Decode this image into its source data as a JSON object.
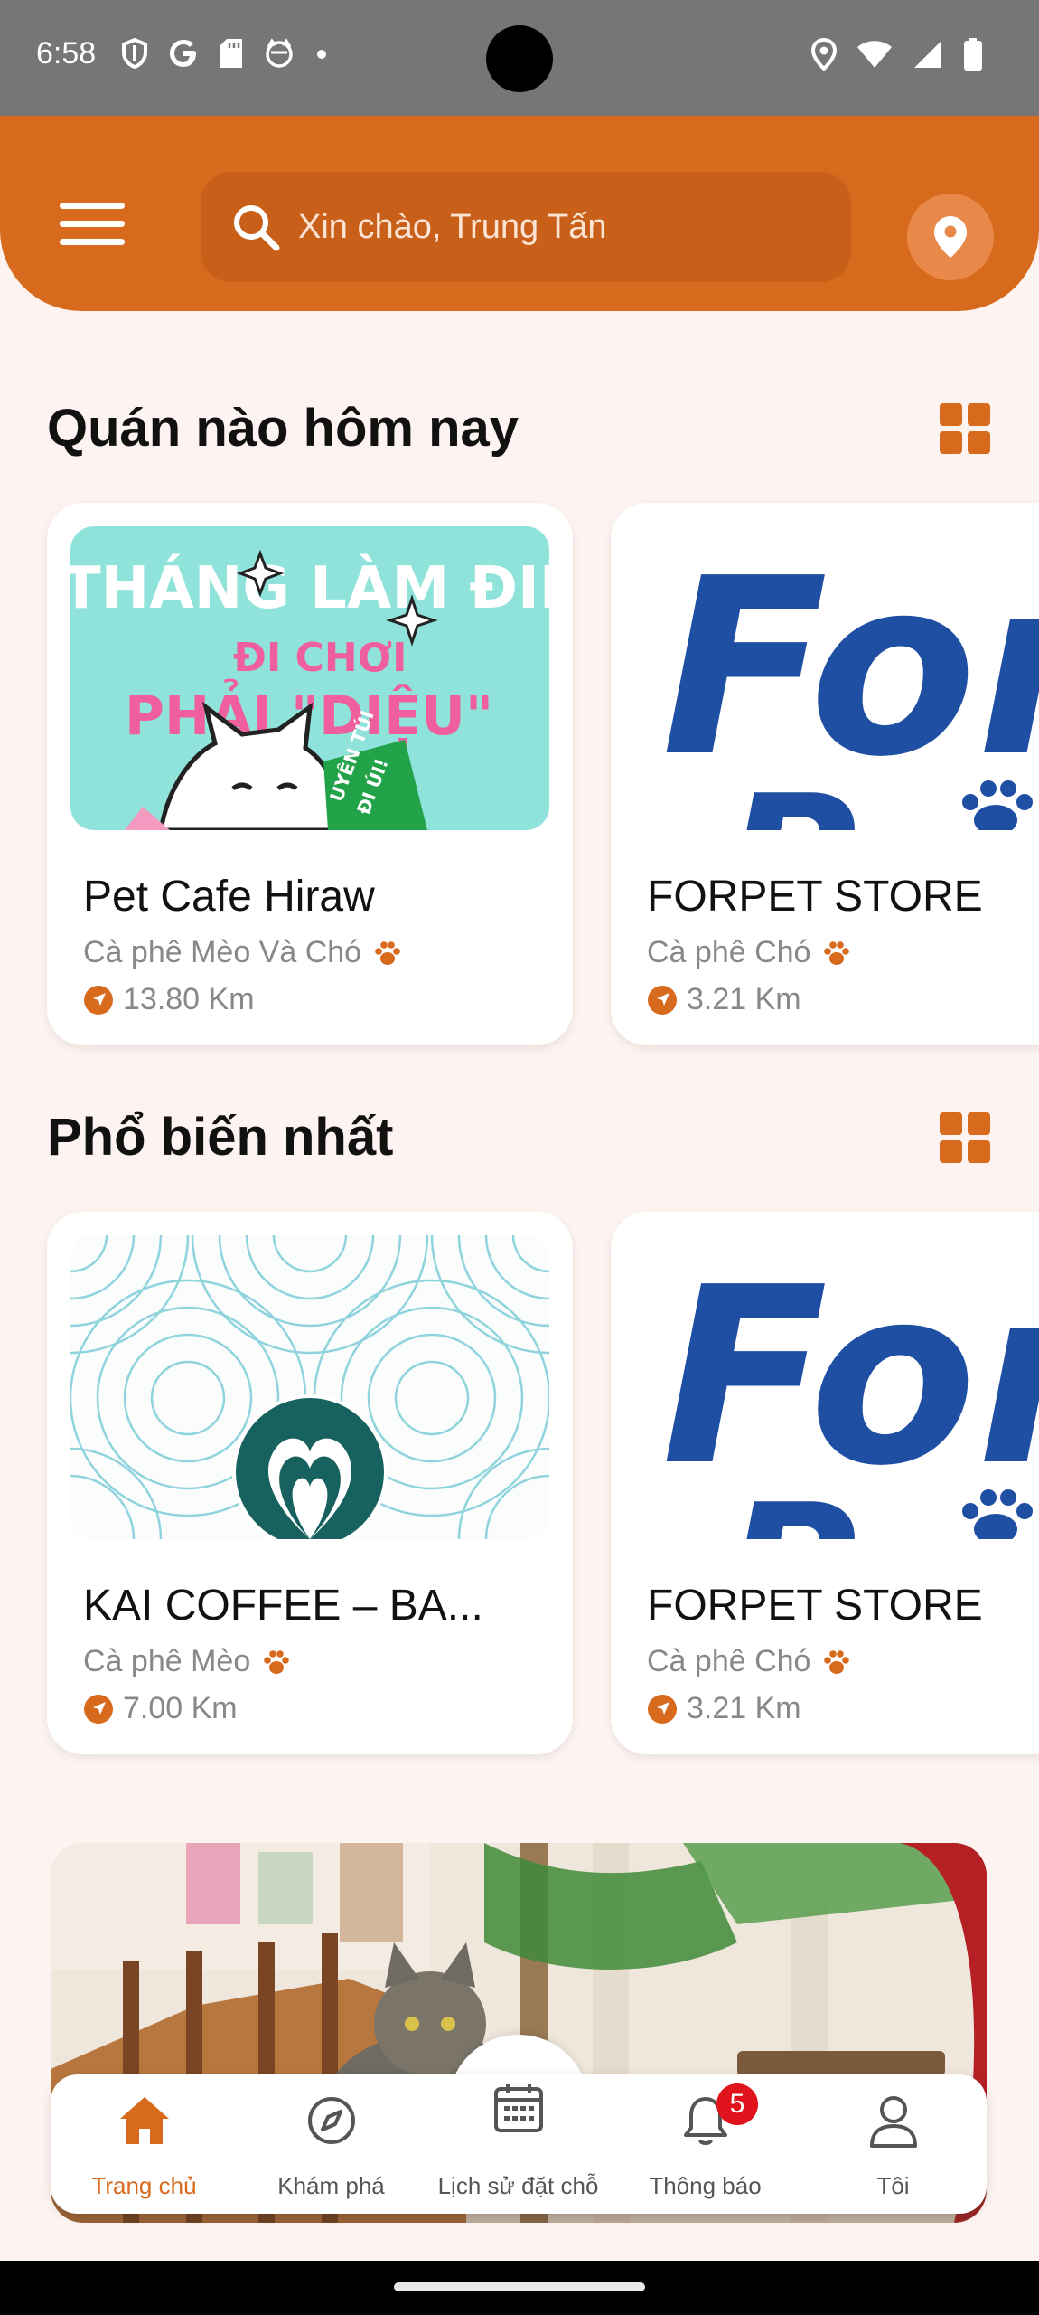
{
  "status_bar": {
    "time": "6:58",
    "left_icons": [
      "shield-icon",
      "google-icon",
      "sd-card-icon",
      "cat-face-icon",
      "dot-icon"
    ],
    "right_icons": [
      "location-icon",
      "wifi-icon",
      "signal-icon",
      "battery-icon"
    ]
  },
  "header": {
    "search_placeholder": "Xin chào, Trung Tấn",
    "colors": {
      "primary": "#d76a1c",
      "search_bg": "#c9601a"
    }
  },
  "sections": [
    {
      "title": "Quán nào hôm nay",
      "cards": [
        {
          "name": "Pet Cafe Hiraw",
          "category": "Cà phê Mèo Và Chó",
          "distance": "13.80 Km",
          "image_text": [
            "THÁNG LÀM ĐIỆU",
            "ĐI CHƠI",
            "PHẢI \"DIỆU\"",
            "UYÊN TÚI",
            "ĐI ÚI!"
          ]
        },
        {
          "name": "FORPET STORE",
          "category": "Cà phê Chó",
          "distance": "3.21 Km",
          "image_text": [
            "For",
            "P"
          ]
        }
      ]
    },
    {
      "title": "Phổ biến nhất",
      "cards": [
        {
          "name": "KAI COFFEE – BA...",
          "category": "Cà phê Mèo",
          "distance": "7.00 Km"
        },
        {
          "name": "FORPET STORE",
          "category": "Cà phê Chó",
          "distance": "3.21 Km",
          "image_text": [
            "For",
            "P"
          ]
        }
      ]
    }
  ],
  "bottom_nav": [
    {
      "label": "Trang chủ",
      "icon": "home-icon",
      "active": true
    },
    {
      "label": "Khám phá",
      "icon": "compass-icon",
      "active": false
    },
    {
      "label": "Lịch sử đặt chỗ",
      "icon": "calendar-icon",
      "active": false
    },
    {
      "label": "Thông báo",
      "icon": "bell-icon",
      "active": false,
      "badge": "5"
    },
    {
      "label": "Tôi",
      "icon": "user-icon",
      "active": false
    }
  ]
}
